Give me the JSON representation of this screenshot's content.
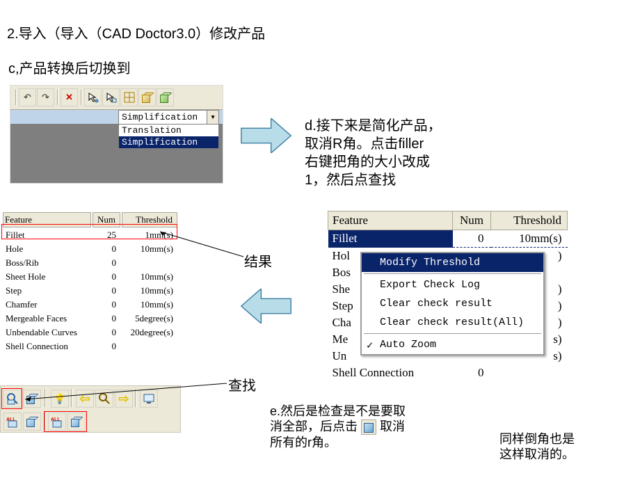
{
  "headline1": "2.导入（导入（CAD Doctor3.0）修改产品",
  "headline2": "c,产品转换后切换到",
  "dropdown": {
    "selected": "Simplification",
    "options": [
      "Translation",
      "Simplification"
    ]
  },
  "text_d": "d.接下来是简化产品，\n取消R角。点击filler\n右键把角的大小改成\n1，然后点查找",
  "result_label": "结果",
  "search_label": "查找",
  "text_e_prefix": "e.然后是检查是不是要取\n消全部，后点击 ",
  "text_e_suffix": " 取消\n所有的r角。",
  "text_note": "同样倒角也是\n这样取消的。",
  "left_table": {
    "headers": [
      "Feature",
      "Num",
      "Threshold"
    ],
    "rows": [
      {
        "feature": "Fillet",
        "num": "25",
        "threshold": "1mm(s)"
      },
      {
        "feature": "Hole",
        "num": "0",
        "threshold": "10mm(s)"
      },
      {
        "feature": "Boss/Rib",
        "num": "0",
        "threshold": ""
      },
      {
        "feature": "Sheet Hole",
        "num": "0",
        "threshold": "10mm(s)"
      },
      {
        "feature": "Step",
        "num": "0",
        "threshold": "10mm(s)"
      },
      {
        "feature": "Chamfer",
        "num": "0",
        "threshold": "10mm(s)"
      },
      {
        "feature": "Mergeable Faces",
        "num": "0",
        "threshold": "5degree(s)"
      },
      {
        "feature": "Unbendable Curves",
        "num": "0",
        "threshold": "20degree(s)"
      },
      {
        "feature": "Shell Connection",
        "num": "0",
        "threshold": ""
      }
    ]
  },
  "right_table": {
    "headers": [
      "Feature",
      "Num",
      "Threshold"
    ],
    "rows": [
      {
        "feature": "Fillet",
        "num": "0",
        "threshold": "10mm(s)"
      },
      {
        "feature": "Hol",
        "num": "",
        "threshold": ")"
      },
      {
        "feature": "Bos",
        "num": "",
        "threshold": ""
      },
      {
        "feature": "She",
        "num": "",
        "threshold": ")"
      },
      {
        "feature": "Step",
        "num": "",
        "threshold": ")"
      },
      {
        "feature": "Cha",
        "num": "",
        "threshold": ")"
      },
      {
        "feature": "Me",
        "num": "",
        "threshold": "s)"
      },
      {
        "feature": "Un",
        "num": "",
        "threshold": "s)"
      },
      {
        "feature": "Shell Connection",
        "num": "0",
        "threshold": ""
      }
    ]
  },
  "ctx_menu": {
    "items": [
      {
        "label": "Modify Threshold",
        "selected": true
      },
      {
        "label": "Export Check Log"
      },
      {
        "label": "Clear check result"
      },
      {
        "label": "Clear check result(All)"
      },
      {
        "label": "Auto Zoom",
        "checked": true
      }
    ]
  },
  "toolbar1_icons": [
    "undo",
    "redo",
    "delete",
    "arrow-dot",
    "arrow-elem",
    "grid",
    "box-y",
    "box-g"
  ],
  "toolbar2_row1": [
    "search-box",
    "box",
    "",
    "bulb",
    "arrow-left",
    "zoom",
    "arrow-right",
    "screen"
  ],
  "toolbar2_row2": [
    "all-box",
    "box",
    "",
    "all-box",
    "box"
  ]
}
